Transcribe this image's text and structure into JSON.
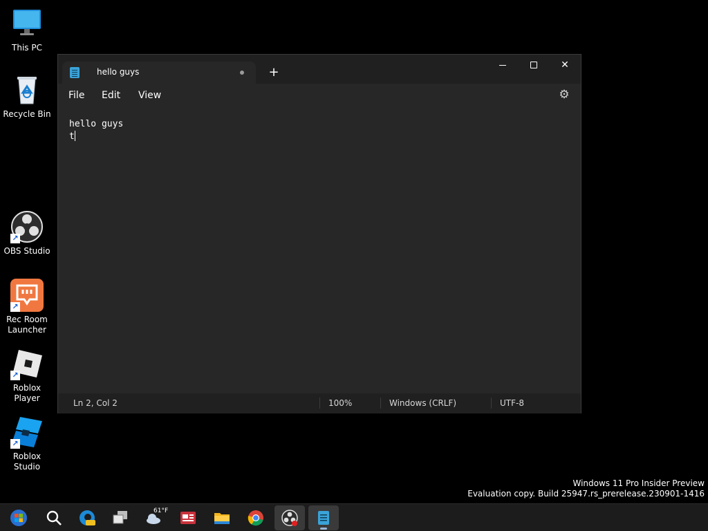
{
  "desktop": {
    "icons": [
      {
        "label": "This PC",
        "icon": "monitor-icon"
      },
      {
        "label": "Recycle Bin",
        "icon": "recycle-bin-icon"
      },
      {
        "label": "OBS Studio",
        "icon": "obs-icon"
      },
      {
        "label": "Rec Room Launcher",
        "icon": "rec-room-icon"
      },
      {
        "label": "Roblox Player",
        "icon": "roblox-icon"
      },
      {
        "label": "Roblox Studio",
        "icon": "roblox-studio-icon"
      }
    ],
    "shortcut_glyph": "↗"
  },
  "notepad": {
    "tab_title": "hello guys",
    "new_tab_glyph": "+",
    "menu": {
      "file": "File",
      "edit": "Edit",
      "view": "View"
    },
    "settings_glyph": "⚙",
    "close_glyph": "✕",
    "content": {
      "line1": "hello guys",
      "line2": "t"
    },
    "status": {
      "position": "Ln 2, Col 2",
      "zoom": "100%",
      "line_ending": "Windows (CRLF)",
      "encoding": "UTF-8"
    }
  },
  "watermark": {
    "line1": "Windows 11 Pro Insider Preview",
    "line2": "Evaluation copy. Build 25947.rs_prerelease.230901-1416"
  },
  "taskbar": {
    "weather_temp": "61°F",
    "items": [
      "start-icon",
      "search-icon",
      "edge-beta-icon",
      "task-view-icon",
      "weather-icon",
      "news-icon",
      "file-explorer-icon",
      "chrome-icon",
      "obs-icon",
      "notepad-icon"
    ]
  },
  "colors": {
    "accent_blue": "#3aa3d8",
    "window_bg": "#272727",
    "titlebar_bg": "#202020"
  }
}
